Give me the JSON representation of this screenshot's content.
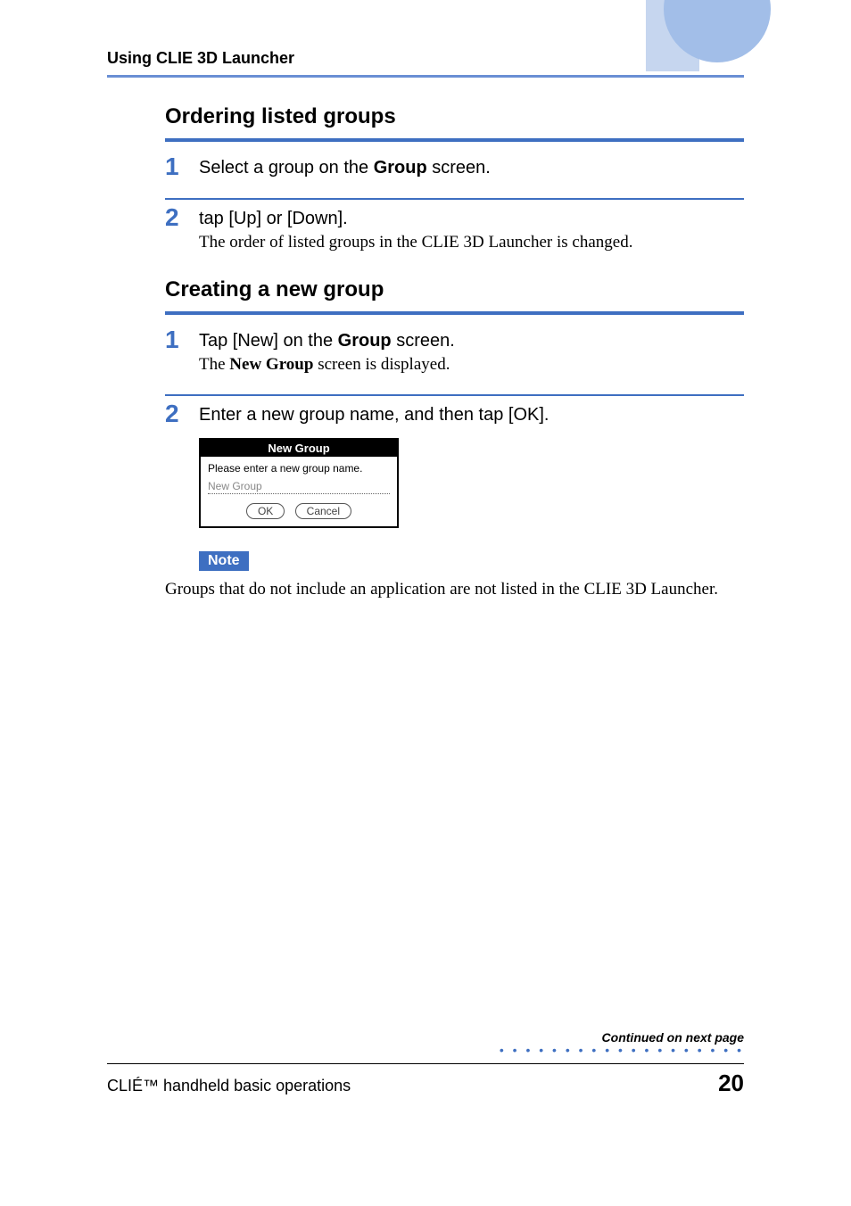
{
  "header": {
    "running": "Using CLIE 3D Launcher"
  },
  "sections": {
    "ordering": {
      "title": "Ordering listed groups",
      "steps": [
        {
          "num": "1",
          "head_pre": "Select a group on the ",
          "head_bold": "Group",
          "head_post": " screen."
        },
        {
          "num": "2",
          "head_plain": "tap [Up] or [Down].",
          "sub": "The order of listed groups in the CLIE 3D Launcher is changed."
        }
      ]
    },
    "creating": {
      "title": "Creating a new group",
      "steps": [
        {
          "num": "1",
          "head_pre": "Tap [New] on the ",
          "head_bold": "Group",
          "head_post": " screen.",
          "sub_pre": "The ",
          "sub_bold": "New Group",
          "sub_post": " screen is displayed."
        },
        {
          "num": "2",
          "head_plain": "Enter a new group name, and then tap [OK]."
        }
      ]
    }
  },
  "dialog": {
    "title": "New Group",
    "prompt": "Please enter a new group name.",
    "input_value": "New Group",
    "ok": "OK",
    "cancel": "Cancel"
  },
  "note": {
    "label": "Note",
    "text": "Groups that do not include an application are not listed in the CLIE 3D Launcher."
  },
  "continued": "Continued on next page",
  "footer": {
    "left": "CLIÉ™ handheld basic operations",
    "page": "20"
  }
}
